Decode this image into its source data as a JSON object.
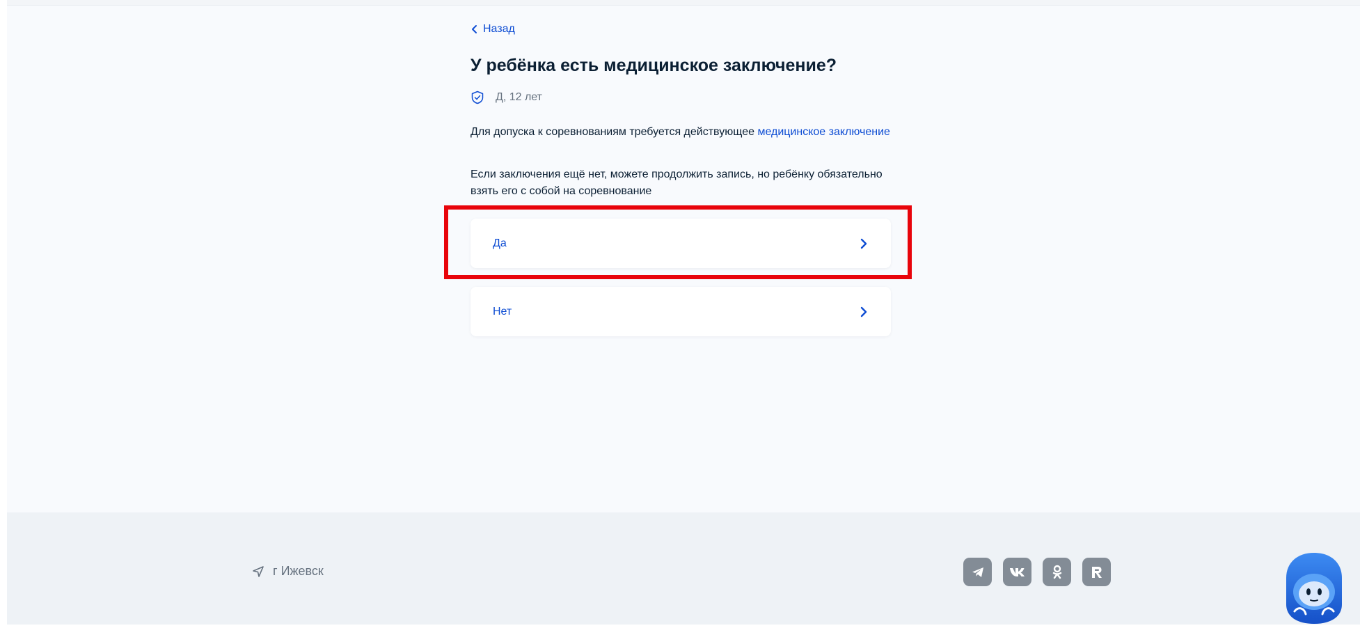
{
  "nav": {
    "back_label": "Назад"
  },
  "question": {
    "title": "У ребёнка есть медицинское заключение?"
  },
  "child": {
    "label": "Д, 12 лет"
  },
  "info": {
    "p1_text": "Для допуска к соревнованиям требуется действующее ",
    "p1_link": "медицинское заключение",
    "p2_text": "Если заключения ещё нет, можете продолжить запись, но ребёнку обязательно взять его с собой на соревнование"
  },
  "options": [
    {
      "label": "Да"
    },
    {
      "label": "Нет"
    }
  ],
  "footer": {
    "city": "г Ижевск",
    "socials": [
      "telegram-icon",
      "vk-icon",
      "ok-icon",
      "rutube-icon"
    ]
  },
  "colors": {
    "accent": "#0d4cd3",
    "highlight": "#e8040b",
    "page_bg": "#f8fafd",
    "footer_bg": "#eef2f6",
    "social_bg": "#838c96"
  }
}
